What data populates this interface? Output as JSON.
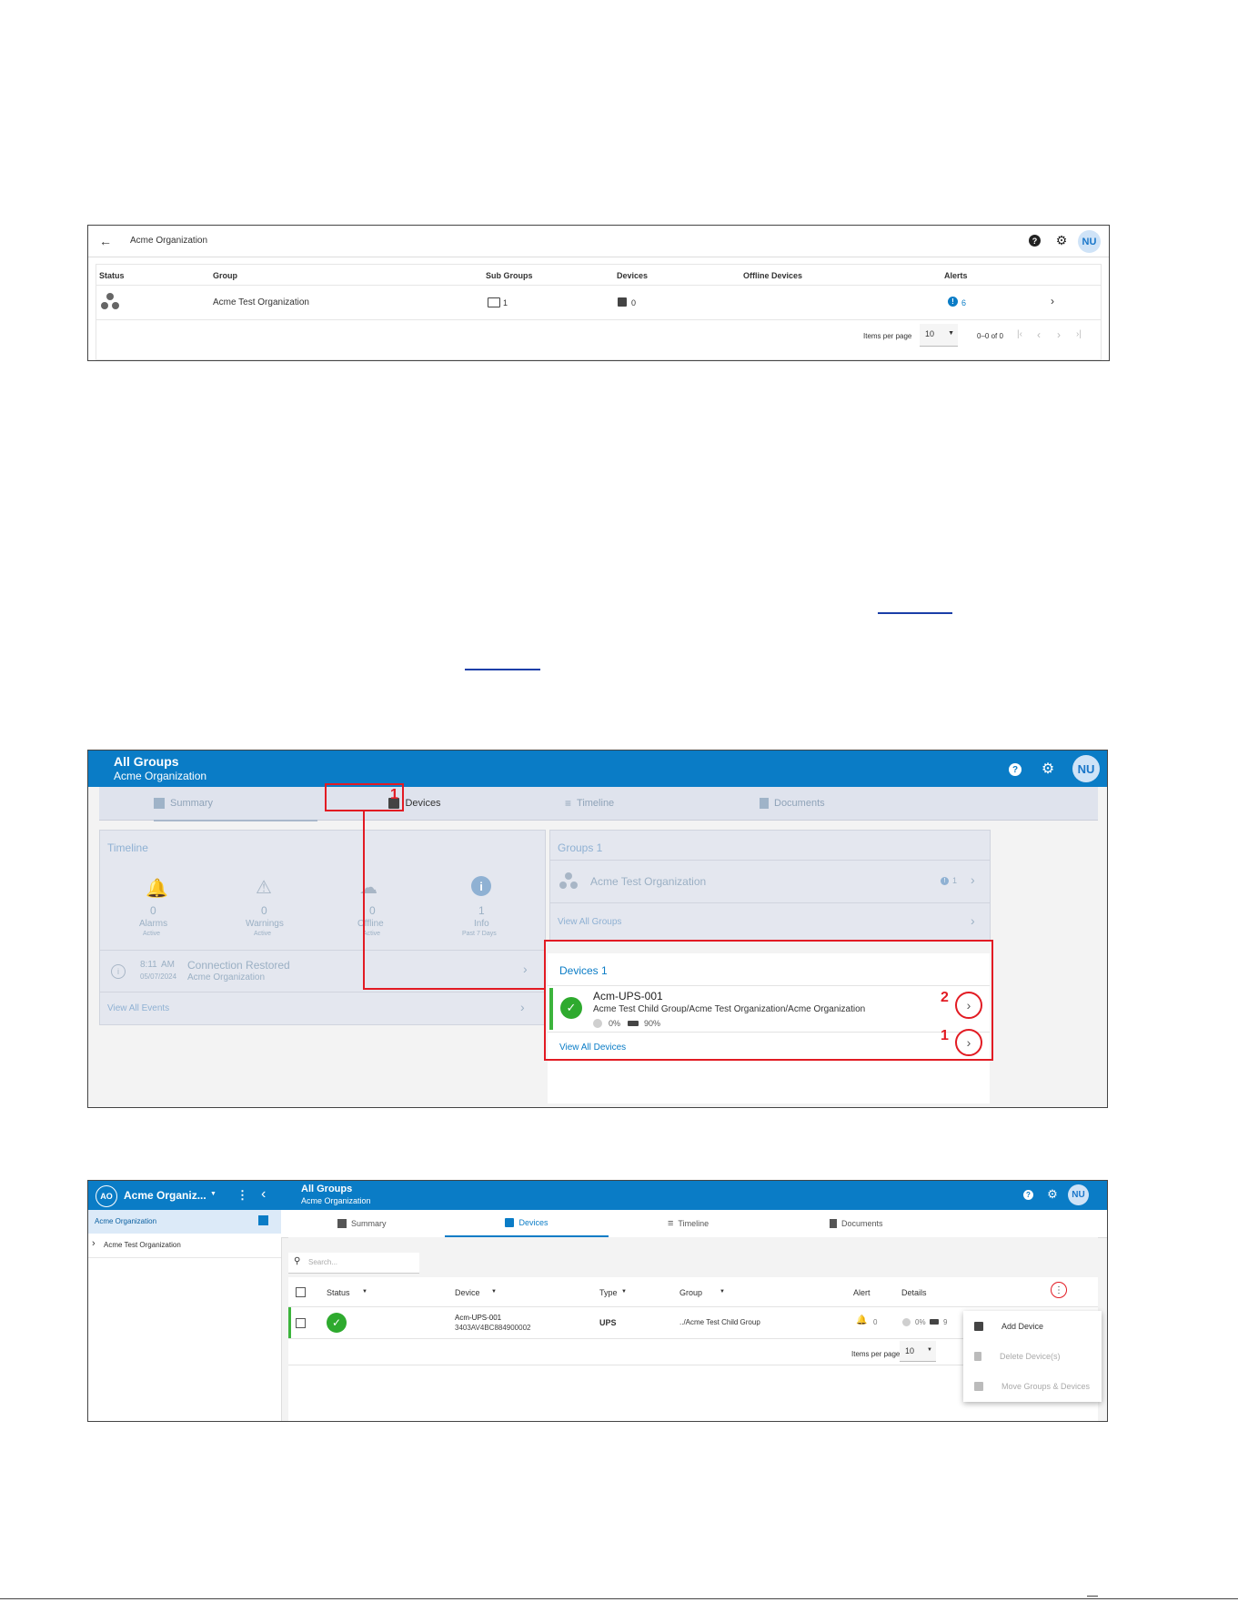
{
  "screenshot1": {
    "title": "Acme Organization",
    "avatar": "NU",
    "columns": [
      "Status",
      "Group",
      "Sub Groups",
      "Devices",
      "Offline Devices",
      "Alerts"
    ],
    "row": {
      "group": "Acme Test Organization",
      "sub_groups": "1",
      "devices": "0",
      "alerts": "6"
    },
    "pager": {
      "items_per_page_label": "Items per page",
      "items_per_page": "10",
      "range": "0–0 of 0"
    }
  },
  "screenshot2": {
    "header_title": "All Groups",
    "header_subtitle": "Acme Organization",
    "avatar": "NU",
    "tabs": [
      "Summary",
      "Devices",
      "Timeline",
      "Documents"
    ],
    "timeline": {
      "title": "Timeline",
      "stats": [
        {
          "value": "0",
          "label": "Alarms",
          "sub": "Active"
        },
        {
          "value": "0",
          "label": "Warnings",
          "sub": "Active"
        },
        {
          "value": "0",
          "label": "Offline",
          "sub": "Active"
        },
        {
          "value": "1",
          "label": "Info",
          "sub": "Past 7 Days"
        }
      ],
      "event_time": "8:11",
      "event_ampm": "AM",
      "event_date": "05/07/2024",
      "event_title": "Connection Restored",
      "event_sub": "Acme Organization",
      "view_all": "View All Events"
    },
    "groups": {
      "title": "Groups 1",
      "item": "Acme Test Organization",
      "item_count": "1",
      "view_all": "View All Groups"
    },
    "devices": {
      "title": "Devices 1",
      "device_name": "Acm-UPS-001",
      "device_path": "Acme Test Child Group/Acme Test Organization/Acme Organization",
      "stat1": "0%",
      "stat2": "90%",
      "view_all": "View All Devices"
    },
    "callouts": {
      "tab": "1",
      "row": "2",
      "view_all": "1"
    }
  },
  "screenshot3": {
    "org_initials": "AO",
    "org_name": "Acme Organiz...",
    "sidebar_items": [
      "Acme Organization",
      "Acme Test Organization"
    ],
    "header_title": "All Groups",
    "header_subtitle": "Acme Organization",
    "avatar": "NU",
    "tabs": [
      "Summary",
      "Devices",
      "Timeline",
      "Documents"
    ],
    "search_placeholder": "Search...",
    "columns": [
      "Status",
      "Device",
      "Type",
      "Group",
      "Alert",
      "Details"
    ],
    "row": {
      "device": "Acm-UPS-001",
      "serial": "3403AV4BC884900002",
      "type": "UPS",
      "group": "../Acme Test Child Group",
      "alert": "0",
      "detail1": "0%",
      "detail2": "9"
    },
    "pager": {
      "items_per_page_label": "Items per page",
      "items_per_page": "10"
    },
    "menu": [
      "Add Device",
      "Delete Device(s)",
      "Move Groups & Devices"
    ]
  }
}
